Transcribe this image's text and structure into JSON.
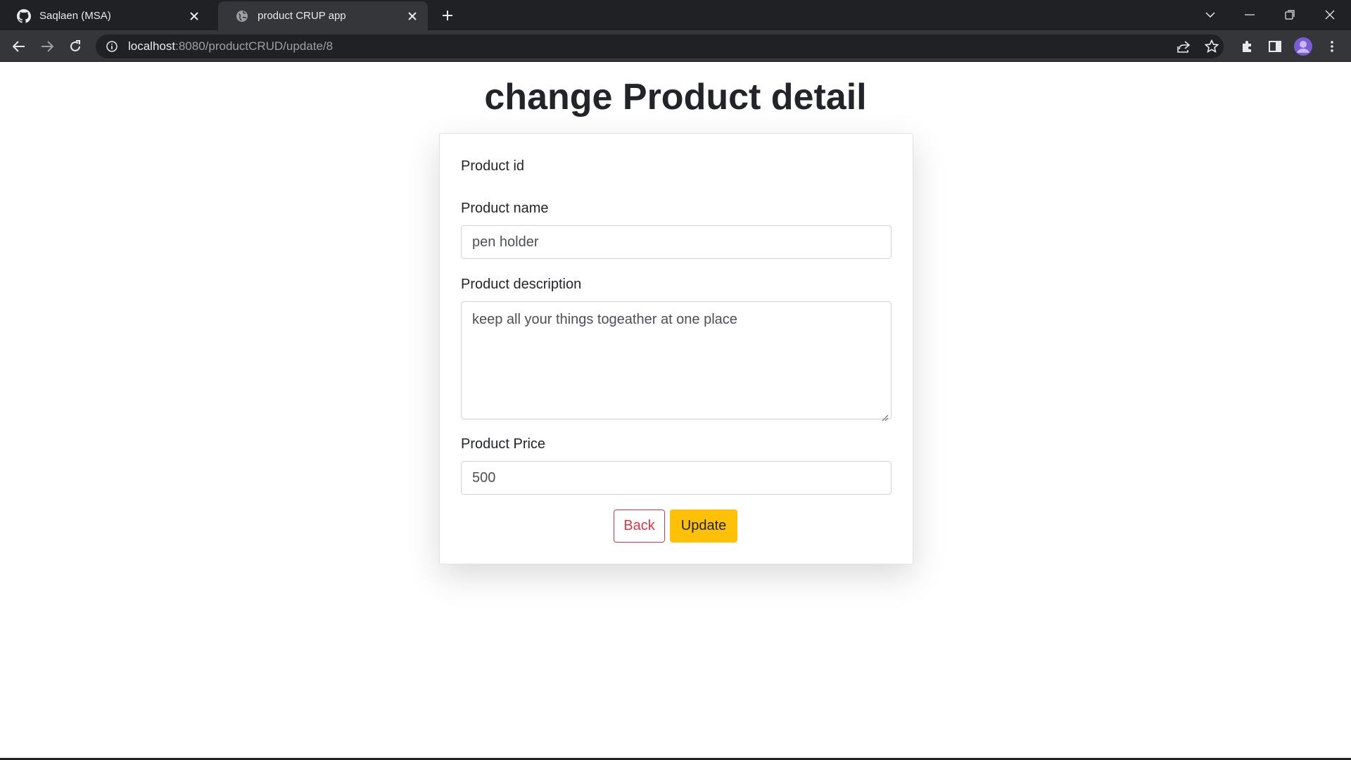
{
  "browser": {
    "tabs": [
      {
        "title": "Saqlaen (MSA)",
        "icon": "github-icon",
        "active": false
      },
      {
        "title": "product CRUP app",
        "icon": "globe-icon",
        "active": true
      }
    ],
    "address": {
      "host": "localhost",
      "path": ":8080/productCRUD/update/8"
    }
  },
  "page": {
    "title": "change Product detail",
    "form": {
      "id_label": "Product id",
      "name_label": "Product name",
      "name_value": "pen holder",
      "description_label": "Product description",
      "description_value": "keep all your things togeather at one place",
      "price_label": "Product Price",
      "price_value": "500",
      "back_label": "Back",
      "update_label": "Update"
    }
  },
  "colors": {
    "chrome_dark": "#202124",
    "chrome_mid": "#35363a",
    "back_button": "#dc3545",
    "update_button": "#ffc107",
    "text": "#212529"
  }
}
